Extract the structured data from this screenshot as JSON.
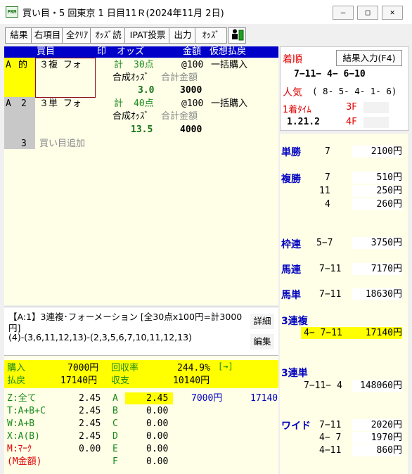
{
  "window": {
    "title": "買い目・5 回東京 1 日目11Ｒ(2024年11月 2日)",
    "icon_text": "PRM",
    "min_label": "—",
    "max_label": "□",
    "close_label": "✕"
  },
  "toolbar": {
    "buttons": [
      "結果",
      "右項目",
      "全ｸﾘｱ",
      "ｵｯｽﾞ読",
      "IPAT投票",
      "出力",
      "ｵｯｽﾞ"
    ]
  },
  "bet_table": {
    "headers": {
      "bet": "買目",
      "mark": "印",
      "odds": "オッズ",
      "amount": "金額",
      "mode": "仮想払戻"
    },
    "rows": [
      {
        "id": "A",
        "num": "的",
        "type": "３複 フォ",
        "odds_label": "計",
        "odds_value": "30点",
        "unit": "@100",
        "mode": "一括購入",
        "sub_odds_label": "合成ｵｯｽﾞ",
        "sub_total_label": "合計金額",
        "synth_odds": "3.0",
        "total": "3000"
      },
      {
        "id": "A",
        "num": "2",
        "type": "３単 フォ",
        "odds_label": "計",
        "odds_value": "40点",
        "unit": "@100",
        "mode": "一括購入",
        "sub_odds_label": "合成ｵｯｽﾞ",
        "sub_total_label": "合計金額",
        "synth_odds": "13.5",
        "total": "4000"
      }
    ],
    "add_row": {
      "num": "3",
      "label": "買い目追加"
    }
  },
  "memo": {
    "line1": "【A:1】3連複･フォーメーション [全30点x100円=計3000",
    "line2": "円]",
    "line3": "(4)-(3,6,11,12,13)-(2,3,5,6,7,10,11,12,13)",
    "detail_button": "詳細",
    "edit_button": "編集"
  },
  "summary": {
    "purchase_label": "購入",
    "purchase_value": "7000円",
    "recovery_label": "回収率",
    "recovery_value": "244.9%",
    "arrow_label": "[→]",
    "refund_label": "払戻",
    "refund_value": "17140円",
    "balance_label": "収支",
    "balance_value": "10140円",
    "filters": [
      {
        "label": "Z:全て",
        "value": "2.45"
      },
      {
        "label": "T:A+B+C",
        "value": "2.45"
      },
      {
        "label": "W:A+B",
        "value": "2.45"
      },
      {
        "label": "X:A(B)",
        "value": "2.45"
      },
      {
        "label": "M:ﾏｰｸ",
        "value": "0.00"
      },
      {
        "label": "(M金額)",
        "value": ""
      }
    ],
    "groups": [
      {
        "label": "A",
        "value": "2.45",
        "amount": "7000円",
        "refund": "17140"
      },
      {
        "label": "B",
        "value": "0.00"
      },
      {
        "label": "C",
        "value": "0.00"
      },
      {
        "label": "D",
        "value": "0.00"
      },
      {
        "label": "E",
        "value": "0.00"
      },
      {
        "label": "F",
        "value": "0.00"
      }
    ]
  },
  "result": {
    "order_label": "着順",
    "input_button": "結果入力(F4)",
    "order_value": "7−11− 4− 6−10",
    "popularity_label": "人気",
    "popularity_value": "( 8- 5- 4- 1- 6)",
    "time_label": "1着ﾀｲﾑ",
    "time_value": "1.21.2",
    "f3_label": "3F",
    "f4_label": "4F"
  },
  "payouts": {
    "tansho": {
      "label": "単勝",
      "rows": [
        {
          "combo": "7",
          "value": "2100円"
        }
      ]
    },
    "fukusho": {
      "label": "複勝",
      "rows": [
        {
          "combo": "7",
          "value": "510円"
        },
        {
          "combo": "11",
          "value": "250円"
        },
        {
          "combo": "4",
          "value": "260円"
        }
      ]
    },
    "wakuren": {
      "label": "枠連",
      "rows": [
        {
          "combo": "5−7",
          "value": "3750円"
        }
      ]
    },
    "umaren": {
      "label": "馬連",
      "rows": [
        {
          "combo": "7−11",
          "value": "7170円"
        }
      ]
    },
    "umatan": {
      "label": "馬単",
      "rows": [
        {
          "combo": "7−11",
          "value": "18630円"
        }
      ]
    },
    "sanrenpuku": {
      "label": "3連複",
      "rows": [
        {
          "combo": "4− 7−11",
          "value": "17140円"
        }
      ]
    },
    "sanrentan": {
      "label": "3連単",
      "rows": [
        {
          "combo": "7−11− 4",
          "value": "148060円"
        }
      ]
    },
    "wide": {
      "label": "ワイド",
      "rows": [
        {
          "combo": "7−11",
          "value": "2020円"
        },
        {
          "combo": "4− 7",
          "value": "1970円"
        },
        {
          "combo": "4−11",
          "value": "860円"
        }
      ]
    }
  }
}
